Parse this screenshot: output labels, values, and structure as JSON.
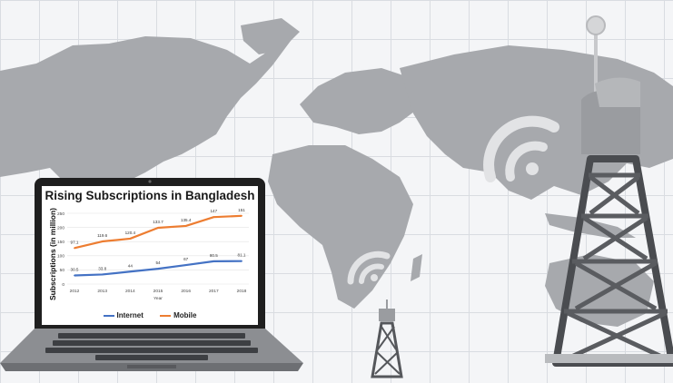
{
  "colors": {
    "internet": "#4472c4",
    "mobile": "#ed7d31",
    "map": "#a7a9ad",
    "tower": "#8e9094"
  },
  "icons": [
    "world-map",
    "laptop",
    "wifi-signal-icon",
    "cell-tower-icon"
  ],
  "chart_data": {
    "type": "line",
    "title": "Rising Subscriptions in Bangladesh",
    "xlabel": "Year",
    "ylabel": "Subscriptions (in million)",
    "x": [
      "2012",
      "2013",
      "2014",
      "2015",
      "2016",
      "2017",
      "2018"
    ],
    "ylim": [
      0,
      250
    ],
    "yticks": [
      "0",
      "50",
      "100",
      "150",
      "200",
      "250"
    ],
    "grid": true,
    "legend": "bottom",
    "series": [
      {
        "name": "Internet",
        "values": [
          30.5,
          33.8,
          44,
          54,
          67,
          80.5,
          81.1
        ],
        "labels": [
          "30.5",
          "33.8",
          "44",
          "54",
          "67",
          "80.5",
          "81.1"
        ]
      },
      {
        "name": "Mobile",
        "values": [
          127.1,
          150.6,
          160.4,
          198.7,
          205.4,
          236.5,
          241.0
        ],
        "labels": [
          "97.1",
          "119.6",
          "120.4",
          "133.7",
          "135.4",
          "147",
          "151"
        ]
      }
    ]
  }
}
